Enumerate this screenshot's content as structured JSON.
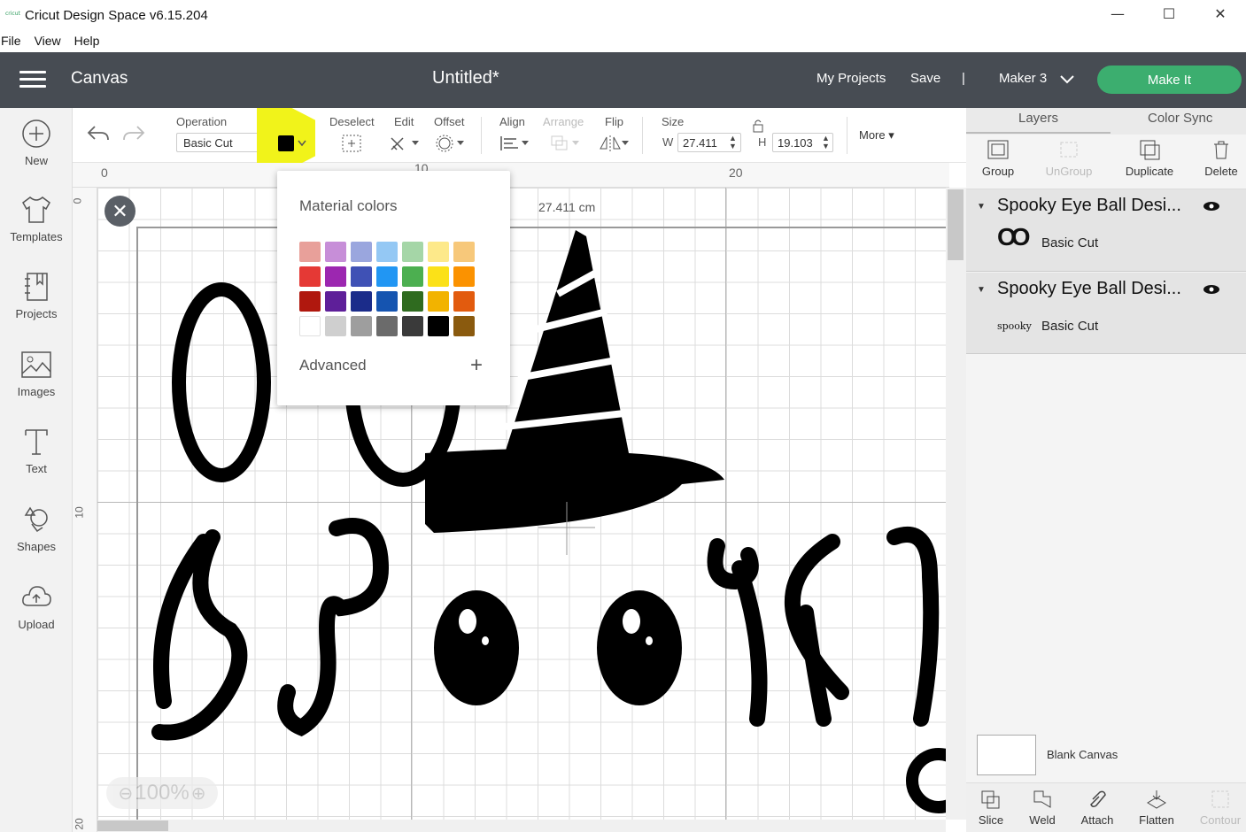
{
  "window": {
    "title": "Cricut Design Space  v6.15.204",
    "logo_text": "cricut",
    "minimize": "—",
    "maximize": "☐",
    "close": "✕"
  },
  "menu": [
    "File",
    "View",
    "Help"
  ],
  "header": {
    "section": "Canvas",
    "doc_title": "Untitled*",
    "my_projects": "My Projects",
    "save": "Save",
    "separator": "|",
    "machine": "Maker 3",
    "make_it": "Make It"
  },
  "sidebar": [
    {
      "label": "New",
      "icon": "plus-circle-icon"
    },
    {
      "label": "Templates",
      "icon": "shirt-icon"
    },
    {
      "label": "Projects",
      "icon": "notebook-icon"
    },
    {
      "label": "Images",
      "icon": "image-icon"
    },
    {
      "label": "Text",
      "icon": "text-t-icon"
    },
    {
      "label": "Shapes",
      "icon": "shapes-icon"
    },
    {
      "label": "Upload",
      "icon": "cloud-upload-icon"
    }
  ],
  "toolbar": {
    "operation_label": "Operation",
    "operation_value": "Basic Cut",
    "color_swatch": "#000000",
    "deselect": "Deselect",
    "edit": "Edit",
    "offset": "Offset",
    "align": "Align",
    "arrange": "Arrange",
    "flip": "Flip",
    "size": "Size",
    "w_label": "W",
    "w_value": "27.411",
    "h_label": "H",
    "h_value": "19.103",
    "more": "More ▾"
  },
  "rulers": {
    "top": [
      "0",
      "10",
      "20"
    ],
    "left": [
      "0",
      "10",
      "20"
    ]
  },
  "canvas": {
    "dimension": "27.411 cm",
    "zoom": "100%"
  },
  "color_popup": {
    "title": "Material colors",
    "advanced": "Advanced",
    "add": "+",
    "colors": [
      "#e8a09a",
      "#c78ed8",
      "#9aa6de",
      "#94c8f4",
      "#a5d6a7",
      "#fde98a",
      "#f7c87a",
      "#e53935",
      "#9c27b0",
      "#3f51b5",
      "#2196f3",
      "#4caf50",
      "#fbe118",
      "#fb9200",
      "#b0180e",
      "#5e1f99",
      "#1b2c8a",
      "#1554b0",
      "#2f6b1f",
      "#f2b300",
      "#e25b0e",
      "#ffffff",
      "#cfcfcf",
      "#9e9e9e",
      "#6b6b6b",
      "#3a3a3a",
      "#000000",
      "#8a5a0e"
    ]
  },
  "right_panel": {
    "tabs": [
      "Layers",
      "Color Sync"
    ],
    "tools": [
      {
        "label": "Group",
        "enabled": true
      },
      {
        "label": "UnGroup",
        "enabled": false
      },
      {
        "label": "Duplicate",
        "enabled": true
      },
      {
        "label": "Delete",
        "enabled": true
      }
    ],
    "layers": [
      {
        "name": "Spooky Eye Ball Desi...",
        "sub": "Basic Cut",
        "thumb": "OO"
      },
      {
        "name": "Spooky Eye Ball Desi...",
        "sub": "Basic Cut",
        "thumb": "spooky"
      }
    ],
    "blank_canvas": "Blank Canvas",
    "bottom_tools": [
      {
        "label": "Slice",
        "enabled": true
      },
      {
        "label": "Weld",
        "enabled": true
      },
      {
        "label": "Attach",
        "enabled": true
      },
      {
        "label": "Flatten",
        "enabled": true
      },
      {
        "label": "Contour",
        "enabled": false
      }
    ]
  }
}
